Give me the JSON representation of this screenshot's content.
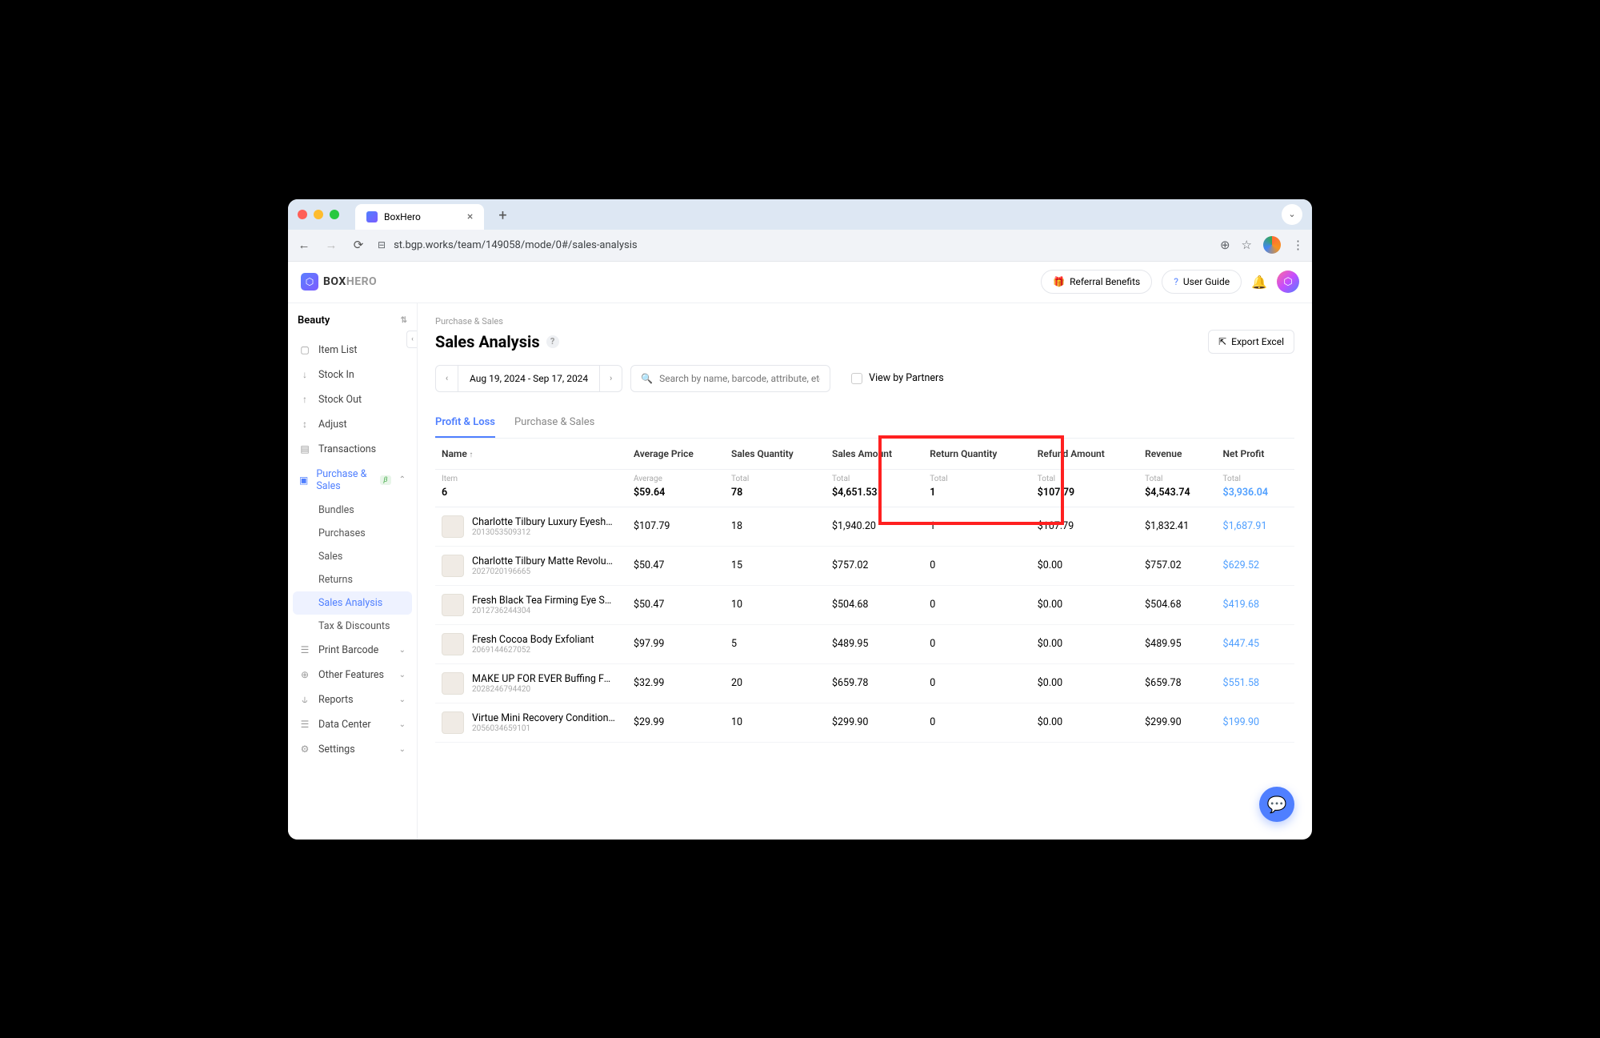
{
  "browser": {
    "tab_title": "BoxHero",
    "url": "st.bgp.works/team/149058/mode/0#/sales-analysis"
  },
  "header": {
    "logo_box": "BOX",
    "logo_hero": "HERO",
    "referral": "Referral Benefits",
    "user_guide": "User Guide"
  },
  "sidebar": {
    "workspace": "Beauty",
    "items": {
      "item_list": "Item List",
      "stock_in": "Stock In",
      "stock_out": "Stock Out",
      "adjust": "Adjust",
      "transactions": "Transactions",
      "purchase_sales": "Purchase & Sales",
      "ps_badge": "β",
      "bundles": "Bundles",
      "purchases": "Purchases",
      "sales": "Sales",
      "returns": "Returns",
      "sales_analysis": "Sales Analysis",
      "tax_discounts": "Tax & Discounts",
      "print_barcode": "Print Barcode",
      "other_features": "Other Features",
      "reports": "Reports",
      "data_center": "Data Center",
      "settings": "Settings"
    }
  },
  "page": {
    "breadcrumb": "Purchase & Sales",
    "title": "Sales Analysis",
    "export": "Export Excel",
    "date_range": "Aug 19, 2024 - Sep 17, 2024",
    "search_placeholder": "Search by name, barcode, attribute, etc.",
    "view_partners": "View by Partners",
    "tabs": {
      "profit_loss": "Profit & Loss",
      "purchase_sales": "Purchase & Sales"
    }
  },
  "table": {
    "headers": {
      "name": "Name",
      "avg_price": "Average Price",
      "sales_qty": "Sales Quantity",
      "sales_amt": "Sales Amount",
      "return_qty": "Return Quantity",
      "refund_amt": "Refund Amount",
      "revenue": "Revenue",
      "net_profit": "Net Profit"
    },
    "totals": {
      "item_label": "Item",
      "item": "6",
      "avg_label": "Average",
      "avg": "$59.64",
      "sq_label": "Total",
      "sq": "78",
      "sa_label": "Total",
      "sa": "$4,651.53",
      "rq_label": "Total",
      "rq": "1",
      "ra_label": "Total",
      "ra": "$107.79",
      "rev_label": "Total",
      "rev": "$4,543.74",
      "np_label": "Total",
      "np": "$3,936.04"
    },
    "rows": [
      {
        "name": "Charlotte Tilbury Luxury Eyeshadow Palette ...",
        "sku": "2013053509312",
        "avg": "$107.79",
        "sq": "18",
        "sa": "$1,940.20",
        "rq": "1",
        "ra": "$107.79",
        "rev": "$1,832.41",
        "np": "$1,687.91"
      },
      {
        "name": "Charlotte Tilbury Matte Revolution Lipstick- ...",
        "sku": "2027020196665",
        "avg": "$50.47",
        "sq": "15",
        "sa": "$757.02",
        "rq": "0",
        "ra": "$0.00",
        "rev": "$757.02",
        "np": "$629.52"
      },
      {
        "name": "Fresh Black Tea Firming Eye Serum",
        "sku": "2012736244304",
        "avg": "$50.47",
        "sq": "10",
        "sa": "$504.68",
        "rq": "0",
        "ra": "$0.00",
        "rev": "$504.68",
        "np": "$419.68"
      },
      {
        "name": "Fresh Cocoa Body Exfoliant",
        "sku": "2069144627052",
        "avg": "$97.99",
        "sq": "5",
        "sa": "$489.95",
        "rq": "0",
        "ra": "$0.00",
        "rev": "$489.95",
        "np": "$447.45"
      },
      {
        "name": "MAKE UP FOR EVER Buffing Foundation Bru...",
        "sku": "2028246794420",
        "avg": "$32.99",
        "sq": "20",
        "sa": "$659.78",
        "rq": "0",
        "ra": "$0.00",
        "rev": "$659.78",
        "np": "$551.58"
      },
      {
        "name": "Virtue Mini Recovery Conditioner",
        "sku": "2056034659101",
        "avg": "$29.99",
        "sq": "10",
        "sa": "$299.90",
        "rq": "0",
        "ra": "$0.00",
        "rev": "$299.90",
        "np": "$199.90"
      }
    ]
  }
}
